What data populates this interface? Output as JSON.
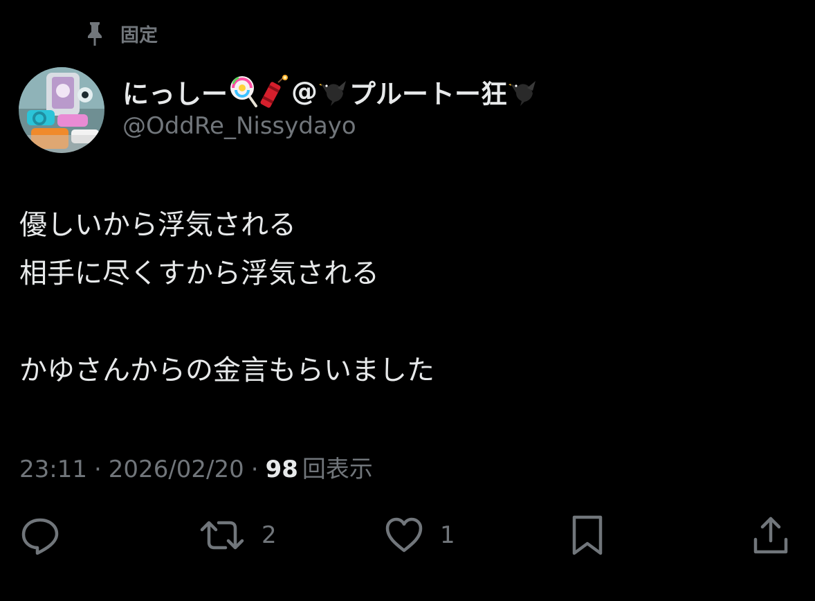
{
  "pinned": {
    "icon": "pin-icon",
    "label": "固定"
  },
  "author": {
    "avatar": "avatar-image",
    "name_parts": [
      "にっしー",
      "@",
      "プルートー狂"
    ],
    "emojis": [
      "lollipop-emoji",
      "firecracker-emoji",
      "blackbird-emoji",
      "blackbird-emoji"
    ],
    "handle": "@OddRe_Nissydayo"
  },
  "tweet": {
    "lines": [
      "優しいから浮気される",
      "相手に尽くすから浮気される",
      "",
      "かゆさんからの金言もらいました"
    ]
  },
  "meta": {
    "time": "23:11",
    "date": "2026/02/20",
    "views_count": "98",
    "views_label": "回表示",
    "separator": "·"
  },
  "actions": {
    "reply": {
      "icon": "reply-icon",
      "count": ""
    },
    "retweet": {
      "icon": "retweet-icon",
      "count": "2"
    },
    "like": {
      "icon": "heart-icon",
      "count": "1"
    },
    "bookmark": {
      "icon": "bookmark-icon",
      "count": ""
    },
    "share": {
      "icon": "share-icon",
      "count": ""
    }
  },
  "colors": {
    "background": "#000000",
    "primary_text": "#e7e9ea",
    "secondary_text": "#71767b"
  }
}
